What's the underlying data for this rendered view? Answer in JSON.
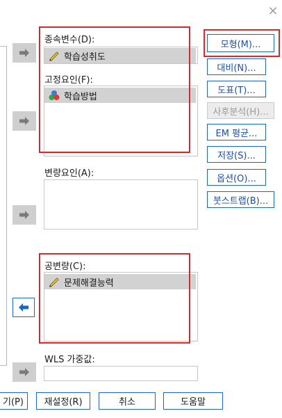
{
  "window": {
    "close_glyph": "×"
  },
  "dependent": {
    "label": "종속변수(D):",
    "item": "학습성취도"
  },
  "fixed": {
    "label": "고정요인(F):",
    "item": "학습방법"
  },
  "random": {
    "label": "변량요인(A):"
  },
  "covariate": {
    "label": "공변량(C):",
    "item": "문제해결능력"
  },
  "wls": {
    "label": "WLS 가중값:"
  },
  "side_buttons": {
    "model": "모형(M)...",
    "contrast": "대비(N)...",
    "plots": "도표(T)...",
    "posthoc": "사후분석(H)...",
    "em_means": "EM 평균...",
    "save": "저장(S)...",
    "options": "옵션(O)...",
    "bootstrap": "붓스트랩(B)..."
  },
  "bottom_buttons": {
    "paste": "기(P)",
    "reset": "재설정(R)",
    "cancel": "취소",
    "help": "도움말"
  },
  "colors": {
    "highlight": "#d9262c",
    "accent": "#1a66c8"
  },
  "icons": {
    "scale": "ruler-pencil-icon",
    "nominal": "three-circles-icon",
    "arrow": "arrow-right-icon"
  }
}
